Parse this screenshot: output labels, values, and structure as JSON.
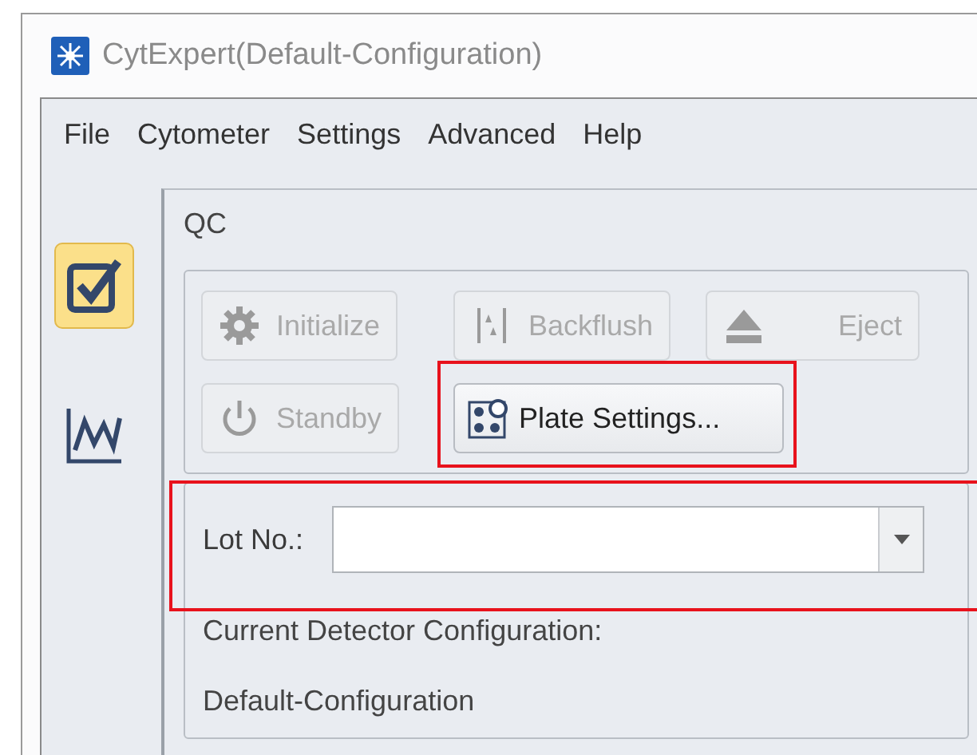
{
  "window": {
    "title": "CytExpert(Default-Configuration)"
  },
  "menu": [
    "File",
    "Cytometer",
    "Settings",
    "Advanced",
    "Help"
  ],
  "sidebar": [
    {
      "kind": "check",
      "selected": true
    },
    {
      "kind": "chart",
      "selected": false
    }
  ],
  "panel": {
    "title": "QC",
    "buttons": [
      {
        "label": "Initialize",
        "kind": "gear",
        "disabled": true,
        "highlighted": false
      },
      {
        "label": "Backflush",
        "kind": "flush",
        "disabled": true,
        "highlighted": false
      },
      {
        "label": "Eject",
        "kind": "eject",
        "disabled": true,
        "highlighted": false
      },
      {
        "label": "Standby",
        "kind": "power",
        "disabled": true,
        "highlighted": false
      },
      {
        "label": "Plate Settings...",
        "kind": "plate",
        "disabled": false,
        "highlighted": true
      }
    ],
    "lot": {
      "label": "Lot No.:",
      "highlighted": true
    },
    "detector_label": "Current Detector Configuration:",
    "detector_value": "Default-Configuration"
  }
}
